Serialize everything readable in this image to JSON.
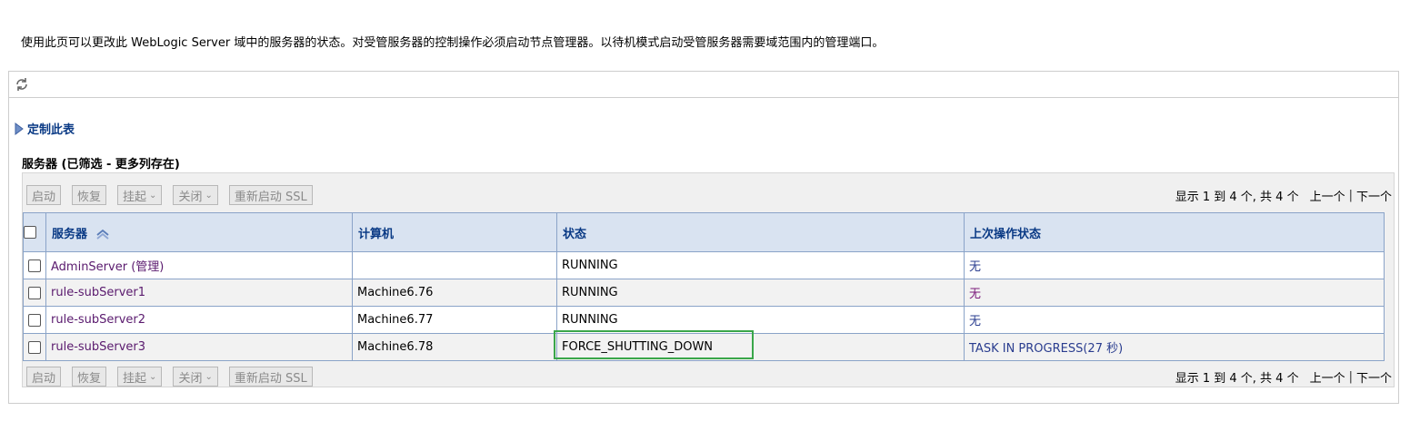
{
  "intro_text": "使用此页可以更改此 WebLogic Server 域中的服务器的状态。对受管服务器的控制操作必须启动节点管理器。以待机模式启动受管服务器需要域范围内的管理端口。",
  "customize_label": "定制此表",
  "table_title": "服务器 (已筛选 - 更多列存在)",
  "toolbar": {
    "start": "启动",
    "resume": "恢复",
    "suspend": "挂起",
    "shutdown": "关闭",
    "restart_ssl": "重新启动 SSL"
  },
  "pager": {
    "count": "显示 1 到 4 个, 共 4 个",
    "prev": "上一个",
    "sep": "|",
    "next": "下一个"
  },
  "columns": {
    "server": "服务器",
    "machine": "计算机",
    "state": "状态",
    "last_action": "上次操作状态"
  },
  "rows": [
    {
      "server": "AdminServer (管理)",
      "machine": "",
      "state": "RUNNING",
      "last_action": "无"
    },
    {
      "server": "rule-subServer1",
      "machine": "Machine6.76",
      "state": "RUNNING",
      "last_action": "无"
    },
    {
      "server": "rule-subServer2",
      "machine": "Machine6.77",
      "state": "RUNNING",
      "last_action": "无"
    },
    {
      "server": "rule-subServer3",
      "machine": "Machine6.78",
      "state": "FORCE_SHUTTING_DOWN",
      "last_action": "TASK IN PROGRESS(27 秒)"
    }
  ],
  "colors": {
    "header_bg": "#d9e3f1",
    "header_text": "#0a3a85",
    "link": "#5a1a6e",
    "highlight": "#3aa64a"
  }
}
